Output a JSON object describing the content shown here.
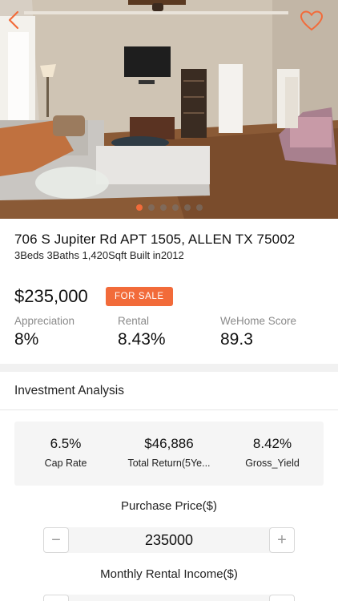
{
  "listing": {
    "address": "706 S Jupiter Rd APT 1505, ALLEN TX 75002",
    "specs": "3Beds 3Baths 1,420Sqft Built in2012",
    "price": "$235,000",
    "status_badge": "FOR SALE"
  },
  "gallery": {
    "image_count": 6,
    "active_index": 0
  },
  "stats": [
    {
      "label": "Appreciation",
      "value": "8%"
    },
    {
      "label": "Rental",
      "value": "8.43%"
    },
    {
      "label": "WeHome Score",
      "value": "89.3"
    }
  ],
  "investment": {
    "title": "Investment Analysis",
    "metrics": [
      {
        "value": "6.5%",
        "label": "Cap Rate"
      },
      {
        "value": "$46,886",
        "label": "Total Return(5Ye..."
      },
      {
        "value": "8.42%",
        "label": "Gross_Yield"
      }
    ],
    "purchase_price": {
      "label": "Purchase Price($)",
      "value": "235000",
      "minus": "−",
      "plus": "+"
    },
    "monthly_rent": {
      "label": "Monthly Rental Income($)",
      "value": "",
      "minus": "−",
      "plus": "+"
    }
  },
  "icons": {
    "back": "chevron-left-icon",
    "favorite": "heart-outline-icon"
  },
  "colors": {
    "accent": "#f26b3a",
    "muted_label": "#8a8a8a",
    "card_bg": "#f5f5f5"
  }
}
